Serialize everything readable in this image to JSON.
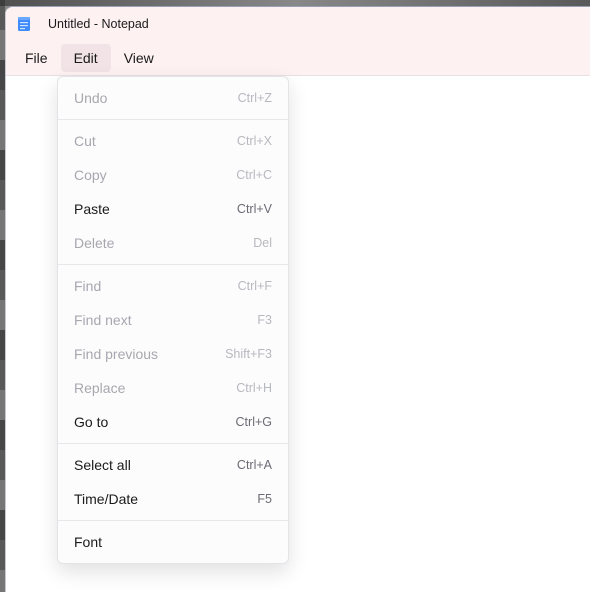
{
  "window": {
    "title": "Untitled - Notepad"
  },
  "menubar": {
    "items": [
      {
        "label": "File"
      },
      {
        "label": "Edit"
      },
      {
        "label": "View"
      }
    ],
    "open_index": 1
  },
  "edit_menu": {
    "groups": [
      [
        {
          "label": "Undo",
          "shortcut": "Ctrl+Z",
          "enabled": false
        }
      ],
      [
        {
          "label": "Cut",
          "shortcut": "Ctrl+X",
          "enabled": false
        },
        {
          "label": "Copy",
          "shortcut": "Ctrl+C",
          "enabled": false
        },
        {
          "label": "Paste",
          "shortcut": "Ctrl+V",
          "enabled": true
        },
        {
          "label": "Delete",
          "shortcut": "Del",
          "enabled": false
        }
      ],
      [
        {
          "label": "Find",
          "shortcut": "Ctrl+F",
          "enabled": false
        },
        {
          "label": "Find next",
          "shortcut": "F3",
          "enabled": false
        },
        {
          "label": "Find previous",
          "shortcut": "Shift+F3",
          "enabled": false
        },
        {
          "label": "Replace",
          "shortcut": "Ctrl+H",
          "enabled": false
        },
        {
          "label": "Go to",
          "shortcut": "Ctrl+G",
          "enabled": true
        }
      ],
      [
        {
          "label": "Select all",
          "shortcut": "Ctrl+A",
          "enabled": true
        },
        {
          "label": "Time/Date",
          "shortcut": "F5",
          "enabled": true
        }
      ],
      [
        {
          "label": "Font",
          "shortcut": "",
          "enabled": true
        }
      ]
    ]
  }
}
